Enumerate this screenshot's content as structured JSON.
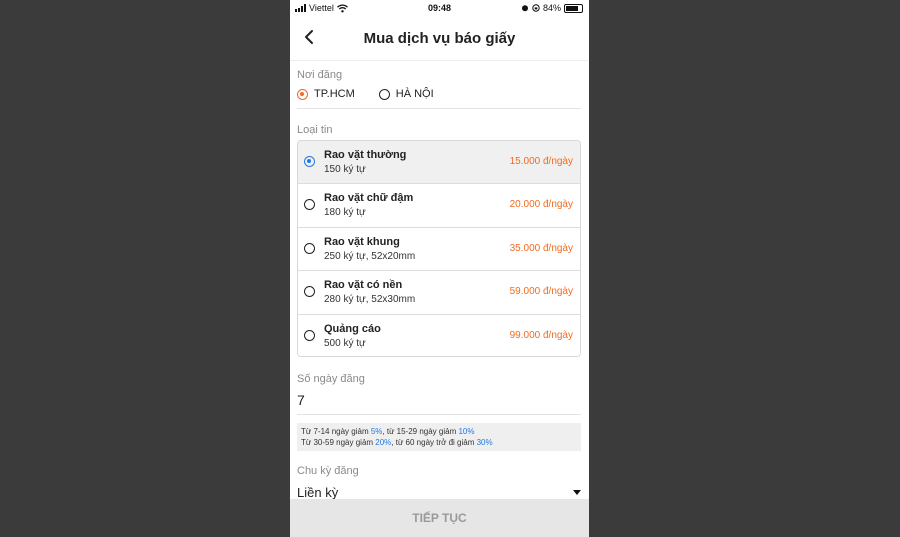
{
  "status_bar": {
    "carrier": "Viettel",
    "time": "09:48",
    "battery": "84%",
    "icons": [
      "signal-icon",
      "wifi-icon",
      "alarm-icon",
      "rotation-lock-icon",
      "battery-icon"
    ]
  },
  "header": {
    "title": "Mua dịch vụ báo giấy",
    "back_icon": "chevron-left-icon"
  },
  "location": {
    "label": "Nơi đăng",
    "options": [
      {
        "label": "TP.HCM",
        "selected": true
      },
      {
        "label": "HÀ NỘI",
        "selected": false
      }
    ]
  },
  "ad_type": {
    "label": "Loại tin",
    "items": [
      {
        "name": "Rao vặt thường",
        "desc": "150 ký tự",
        "price": "15.000 đ/ngày",
        "selected": true
      },
      {
        "name": "Rao vặt chữ đậm",
        "desc": "180 ký tự",
        "price": "20.000 đ/ngày",
        "selected": false
      },
      {
        "name": "Rao vặt khung",
        "desc": "250 ký tự, 52x20mm",
        "price": "35.000 đ/ngày",
        "selected": false
      },
      {
        "name": "Rao vặt có nền",
        "desc": "280 ký tự, 52x30mm",
        "price": "59.000 đ/ngày",
        "selected": false
      },
      {
        "name": "Quảng cáo",
        "desc": "500 ký tự",
        "price": "99.000 đ/ngày",
        "selected": false
      }
    ]
  },
  "days": {
    "label": "Số ngày đăng",
    "value": "7",
    "note_line1_a": "Từ 7-14 ngày giảm ",
    "note_line1_b": "5%",
    "note_line1_c": ", từ 15-29 ngày giảm ",
    "note_line1_d": "10%",
    "note_line2_a": "Từ 30-59 ngày giảm ",
    "note_line2_b": "20%",
    "note_line2_c": ", từ 60 ngày trở đi giảm ",
    "note_line2_d": "30%"
  },
  "cycle": {
    "label": "Chu kỳ đăng",
    "value": "Liền kỳ"
  },
  "continue_label": "TIẾP TỤC",
  "colors": {
    "accent_orange": "#f26b21",
    "accent_blue": "#1e7be8",
    "background": "#3b3b3b"
  }
}
